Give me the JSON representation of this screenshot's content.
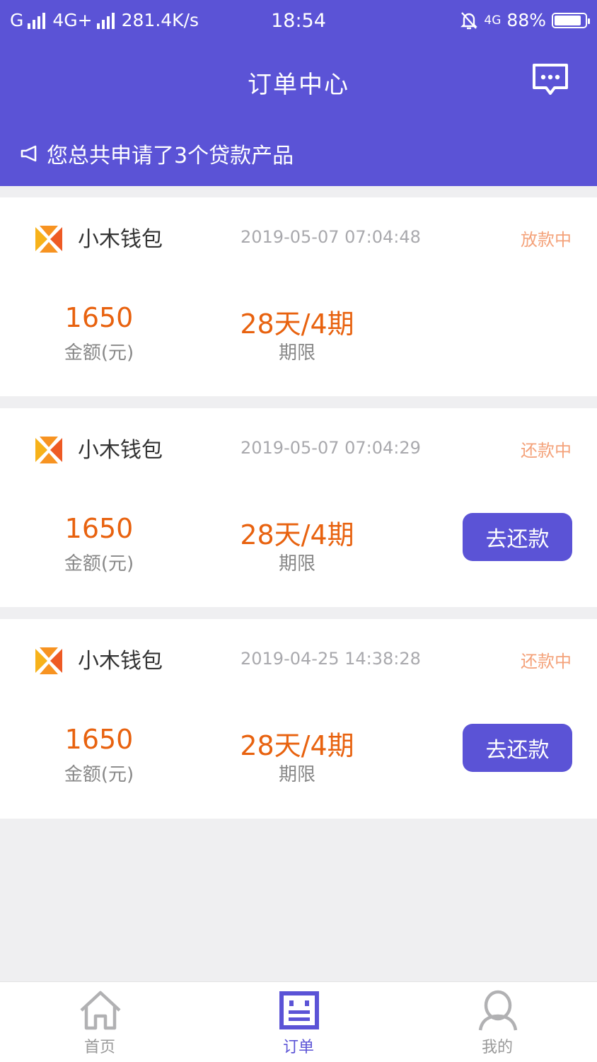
{
  "status_bar": {
    "carrier": "G",
    "network": "4G+",
    "speed": "281.4K/s",
    "time": "18:54",
    "network_right": "4G",
    "battery": "88%",
    "battery_level": 0.88
  },
  "header": {
    "title": "订单中心",
    "notice": "您总共申请了3个贷款产品"
  },
  "orders": [
    {
      "product": "小木钱包",
      "time": "2019-05-07 07:04:48",
      "status": "放款中",
      "amount": "1650",
      "amount_label": "金额(元)",
      "term": "28天/4期",
      "term_label": "期限"
    },
    {
      "product": "小木钱包",
      "time": "2019-05-07 07:04:29",
      "status": "还款中",
      "amount": "1650",
      "amount_label": "金额(元)",
      "term": "28天/4期",
      "term_label": "期限",
      "action": "去还款"
    },
    {
      "product": "小木钱包",
      "time": "2019-04-25 14:38:28",
      "status": "还款中",
      "amount": "1650",
      "amount_label": "金额(元)",
      "term": "28天/4期",
      "term_label": "期限",
      "action": "去还款"
    }
  ],
  "tabs": [
    {
      "label": "首页",
      "icon": "home-icon"
    },
    {
      "label": "订单",
      "icon": "order-icon"
    },
    {
      "label": "我的",
      "icon": "profile-icon"
    }
  ],
  "colors": {
    "accent": "#5b53d6",
    "amount": "#e8620f",
    "status": "#f4a27a"
  }
}
